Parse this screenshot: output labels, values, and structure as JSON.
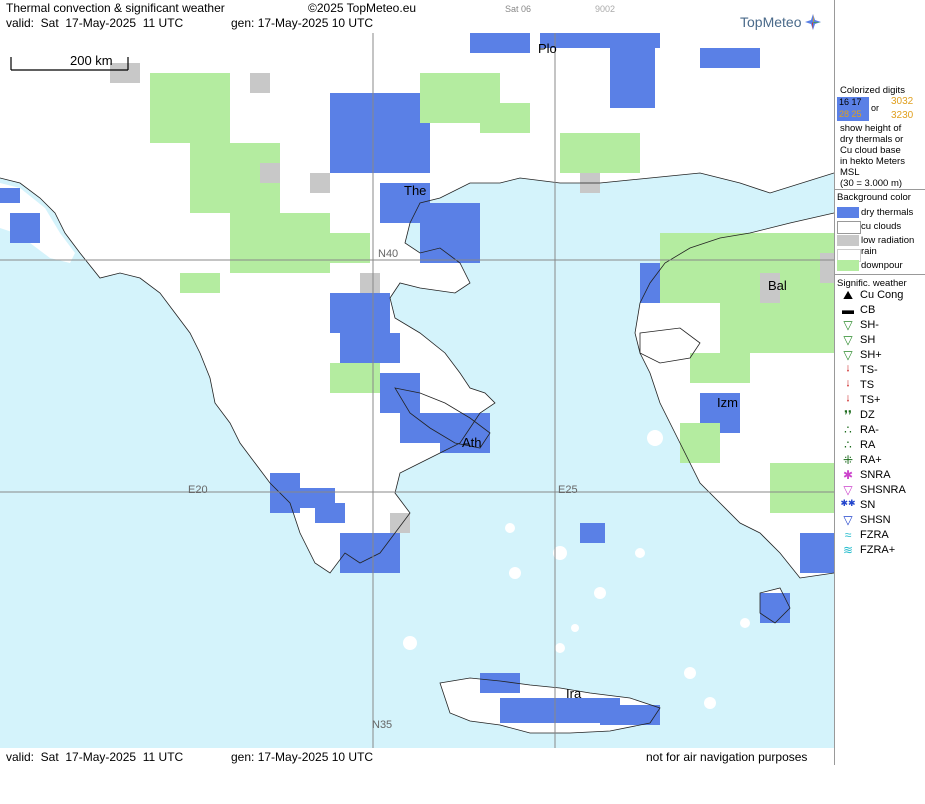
{
  "header": {
    "title": "Thermal convection & significant weather",
    "copyright": "©2025 TopMeteo.eu",
    "valid": "valid:  Sat  17-May-2025  11 UTC",
    "gen": "gen: 17-May-2025 10 UTC",
    "faint_day": "Sat 06",
    "faint_code": "9002",
    "logo": "TopMeteo"
  },
  "map": {
    "scale_label": "200 km",
    "grid_labels": {
      "e20": "E20",
      "e25": "E25",
      "n35": "N35",
      "n40": "N40"
    },
    "places": [
      {
        "code": "Plo"
      },
      {
        "code": "The"
      },
      {
        "code": "Bal"
      },
      {
        "code": "Izm"
      },
      {
        "code": "Ath"
      },
      {
        "code": "Ira"
      }
    ],
    "colors": {
      "sea": "#d4f3fb",
      "land": "#ffffff",
      "dry_thermals": "#5a80e6",
      "downpour": "#b4eca0",
      "low_radiation": "#c8c8c8",
      "grid": "#888888"
    }
  },
  "footer": {
    "valid": "valid:  Sat  17-May-2025  11 UTC",
    "gen": "gen: 17-May-2025 10 UTC",
    "disclaimer": "not for air navigation purposes"
  },
  "legend": {
    "colorized_title": "Colorized digits",
    "sample_black": "16 17",
    "sample_brown": "28 25",
    "sample_or": "or",
    "sample_orange_1": "3032",
    "sample_orange_2": "3230",
    "explain": [
      "show height of",
      "dry thermals or",
      "Cu cloud base",
      "in hekto Meters",
      "MSL",
      "(30 = 3.000 m)"
    ],
    "background_title": "Background color",
    "backgrounds": [
      {
        "label": "dry thermals",
        "color": "#5a80e6"
      },
      {
        "label": "cu clouds",
        "color": "#ffffff"
      },
      {
        "label": "low radiation",
        "color": "#c8c8c8"
      },
      {
        "label": "rain",
        "color": "#ffffff"
      },
      {
        "label": "downpour",
        "color": "#b4eca0"
      }
    ],
    "weather_title": "Signific. weather",
    "weather": [
      {
        "symbol": "⛰",
        "label": "Cu Cong",
        "icon": "cu-cong-icon",
        "color": "#000000"
      },
      {
        "symbol": "▬",
        "label": "CB",
        "icon": "cb-icon",
        "color": "#000000"
      },
      {
        "symbol": "▽",
        "label": "SH-",
        "icon": "shower-light-icon",
        "color": "#2a8a2a"
      },
      {
        "symbol": "▽",
        "label": "SH",
        "icon": "shower-icon",
        "color": "#2a8a2a"
      },
      {
        "symbol": "▽",
        "label": "SH+",
        "icon": "shower-heavy-icon",
        "color": "#2a8a2a"
      },
      {
        "symbol": "ᛍ",
        "label": "TS-",
        "icon": "thunderstorm-light-icon",
        "color": "#cc2222"
      },
      {
        "symbol": "ᛍ",
        "label": "TS",
        "icon": "thunderstorm-icon",
        "color": "#cc2222"
      },
      {
        "symbol": "ᛍ",
        "label": "TS+",
        "icon": "thunderstorm-heavy-icon",
        "color": "#cc2222"
      },
      {
        "symbol": "❜❜",
        "label": "DZ",
        "icon": "drizzle-icon",
        "color": "#1a6a1a"
      },
      {
        "symbol": "∴",
        "label": "RA-",
        "icon": "rain-light-icon",
        "color": "#1a6a1a"
      },
      {
        "symbol": "∴",
        "label": "RA",
        "icon": "rain-icon",
        "color": "#1a6a1a"
      },
      {
        "symbol": "⁜",
        "label": "RA+",
        "icon": "rain-heavy-icon",
        "color": "#1a6a1a"
      },
      {
        "symbol": "✱",
        "label": "SNRA",
        "icon": "snow-rain-icon",
        "color": "#cc44cc"
      },
      {
        "symbol": "▽",
        "label": "SHSNRA",
        "icon": "snow-rain-shower-icon",
        "color": "#cc44cc"
      },
      {
        "symbol": "✱✱",
        "label": "SN",
        "icon": "snow-icon",
        "color": "#2244cc"
      },
      {
        "symbol": "▽",
        "label": "SHSN",
        "icon": "snow-shower-icon",
        "color": "#2244cc"
      },
      {
        "symbol": "≈",
        "label": "FZRA",
        "icon": "freezing-rain-icon",
        "color": "#22bbcc"
      },
      {
        "symbol": "≋",
        "label": "FZRA+",
        "icon": "freezing-rain-heavy-icon",
        "color": "#22bbcc"
      }
    ]
  }
}
